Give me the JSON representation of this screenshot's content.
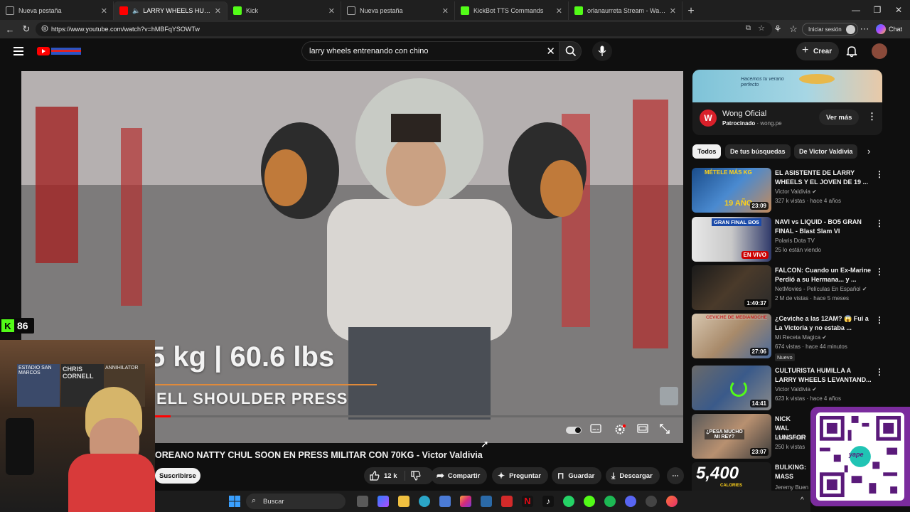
{
  "browser": {
    "tabs": [
      {
        "title": "Nueva pestaña",
        "icon": "newtab-icon",
        "active": false
      },
      {
        "title": "LARRY WHEELS HUMILLA AL CHINO",
        "icon": "youtube-icon",
        "active": true
      },
      {
        "title": "Kick",
        "icon": "kick-icon",
        "active": false
      },
      {
        "title": "Nueva pestaña",
        "icon": "newtab-icon",
        "active": false
      },
      {
        "title": "KickBot TTS Commands",
        "icon": "kick-icon",
        "active": false
      },
      {
        "title": "orlanaurreta Stream - Watch Live on Kick",
        "icon": "kick-icon",
        "active": false
      }
    ],
    "url": "https://www.youtube.com/watch?v=hMBFqYSOWTw",
    "signin_label": "Iniciar sesión",
    "chat_label": "Chat"
  },
  "youtube": {
    "search_value": "larry wheels  entrenando con chino",
    "create_label": "Crear"
  },
  "video": {
    "overlay_weight": "5 kg | 60.6 lbs",
    "overlay_exercise": "ELL SHOULDER PRESS",
    "title": "OREANO NATTY CHUL SOON EN PRESS MILITAR CON 70KG - Victor Valdivia",
    "subscribe_label": "Suscribirse",
    "likes": "12 k",
    "share_label": "Compartir",
    "ask_label": "Preguntar",
    "save_label": "Guardar",
    "download_label": "Descargar"
  },
  "ad": {
    "banner_text": "Hacemos tu verano perfecto",
    "advertiser": "Wong Oficial",
    "sponsored": "Patrocinado",
    "domain": "wong.pe",
    "cta": "Ver más"
  },
  "chips": [
    "Todos",
    "De tus búsquedas",
    "De Victor Valdivia"
  ],
  "recommendations": [
    {
      "title": "EL ASISTENTE DE LARRY WHEELS Y EL JOVEN DE 19 ...",
      "channel": "Victor Valdivia",
      "verified": true,
      "meta": "327 k vistas · hace 4 años",
      "duration": "23:09",
      "thumb_text": "19 AÑO",
      "thumb_top": "MÉTELE MÁS KG"
    },
    {
      "title": "NAVI vs LIQUID - BO5 GRAN FINAL - Blast Slam VI",
      "channel": "Polaris Dota TV",
      "verified": false,
      "meta": "25 lo están viendo",
      "duration": "EN VIVO",
      "thumb_text": "",
      "thumb_top": "GRAN FINAL BO5"
    },
    {
      "title": "FALCON: Cuando un Ex-Marine Perdió a su Hermana... y ...",
      "channel": "NetMovies - Películas En Español",
      "verified": true,
      "meta": "2 M de vistas · hace 5 meses",
      "duration": "1:40:37",
      "thumb_text": "",
      "thumb_top": ""
    },
    {
      "title": "¿Ceviche a las 12AM? 😱 Fui a La Victoria y no estaba ...",
      "channel": "Mi Receta Magica",
      "verified": true,
      "meta": "674 vistas · hace 44 minutos",
      "duration": "27:06",
      "badge": "Nuevo",
      "thumb_text": "",
      "thumb_top": "CEVICHE DE MEDIANOCHE"
    },
    {
      "title": "CULTURISTA HUMILLA A LARRY WHEELS LEVANTAND...",
      "channel": "Victor Valdivia",
      "verified": true,
      "meta": "623 k vistas · hace 4 años",
      "duration": "14:41",
      "thumb_text": "",
      "thumb_top": ""
    },
    {
      "title": "NICK WAL LUNSFOR",
      "channel": "Victor Valdiv",
      "verified": false,
      "meta": "250 k vistas",
      "duration": "23:07",
      "thumb_text": "¿PESA MUCHO MI REY?",
      "thumb_top": ""
    },
    {
      "title": "BULKING: MASS",
      "channel": "Jeremy Buen",
      "verified": false,
      "meta": "",
      "duration": "",
      "thumb_text": "5,400",
      "thumb_top": "CALORIES"
    }
  ],
  "stream_overlay": {
    "kick_viewers": "86",
    "poster_1": "CHRIS CORNELL",
    "poster_2": "ANNIHILATOR",
    "poster_3": "ESTADIO SAN MARCOS",
    "qr_brand": "yape"
  },
  "taskbar": {
    "search_placeholder": "Buscar"
  },
  "colors": {
    "youtube_red": "#ff0000",
    "kick_green": "#53fc18",
    "yape_purple": "#7b2c9e",
    "bg": "#0f0f0f"
  }
}
